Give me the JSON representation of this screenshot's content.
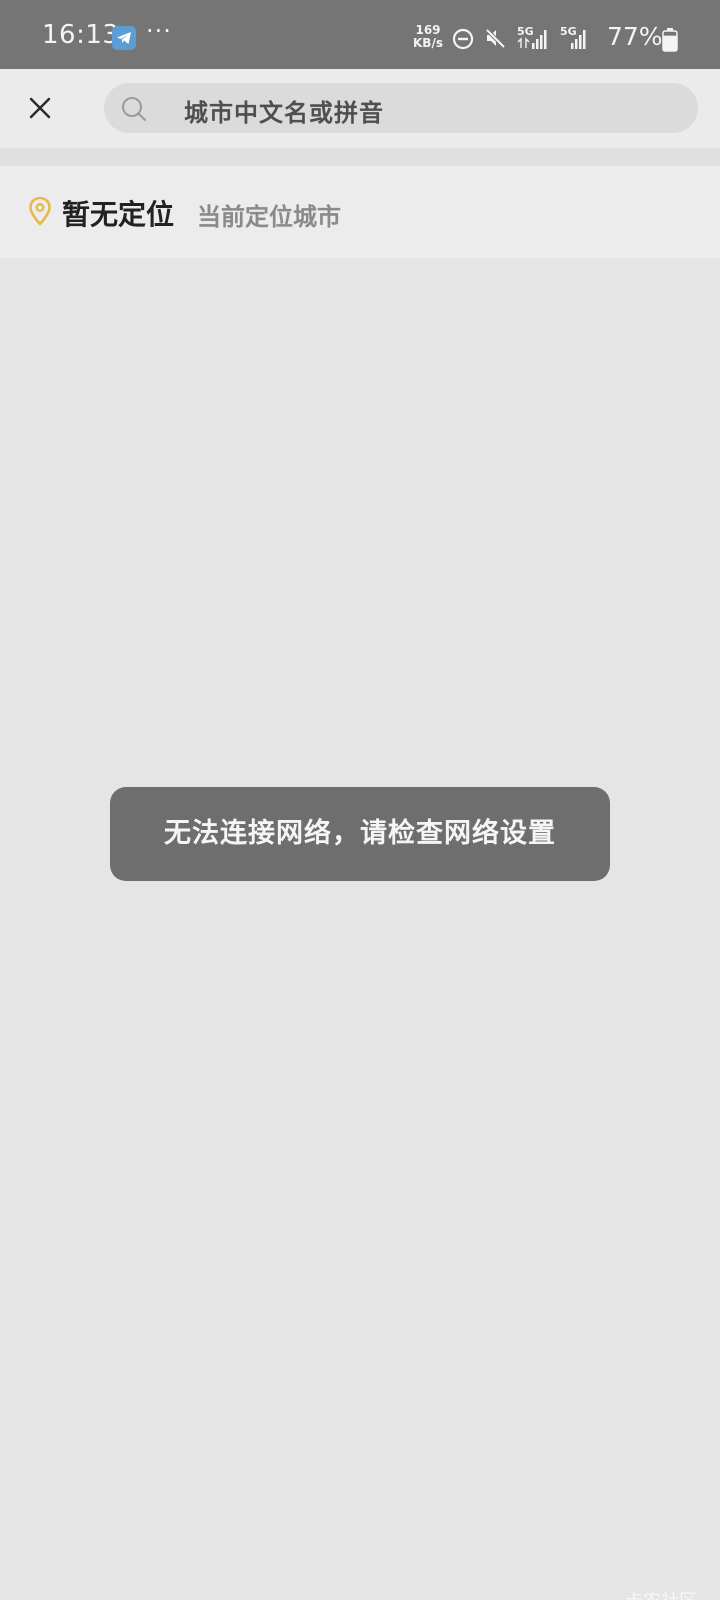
{
  "status_bar": {
    "time": "16:13",
    "app_icon": "telegram-icon",
    "more": "···",
    "net_speed_value": "169",
    "net_speed_unit": "KB/s",
    "dnd_icon": "do-not-disturb-icon",
    "mute_icon": "mute-icon",
    "signal_1_label": "5G",
    "signal_2_label": "5G",
    "battery_percent": "77%",
    "battery_icon": "battery-icon",
    "battery_level": 0.77
  },
  "header": {
    "close_icon": "close-icon",
    "search_icon": "search-icon",
    "search_placeholder": "城市中文名或拼音"
  },
  "location": {
    "pin_icon": "location-pin-icon",
    "current": "暂无定位",
    "hint": "当前定位城市"
  },
  "toast": {
    "message": "无法连接网络，请检查网络设置"
  },
  "watermark": "卡农社区",
  "colors": {
    "status_bar_bg": "#757575",
    "page_bg": "#e5e5e5",
    "search_box_bg": "#dbdbdb",
    "pin_color": "#e6b84e",
    "toast_bg": "#6e6e6e"
  }
}
